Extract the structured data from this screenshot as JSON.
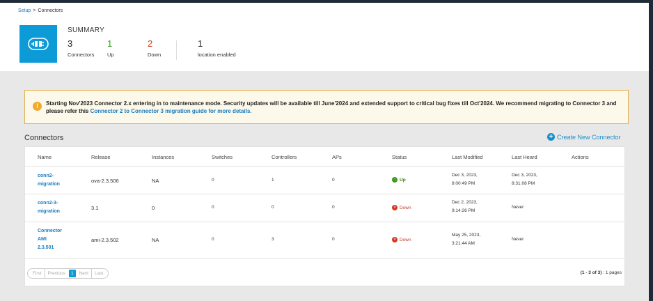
{
  "breadcrumb": {
    "root": "Setup",
    "separator": ">",
    "current": "Connectors"
  },
  "summary": {
    "title": "SUMMARY",
    "stats": [
      {
        "value": "3",
        "label": "Connectors"
      },
      {
        "value": "1",
        "label": "Up"
      },
      {
        "value": "2",
        "label": "Down"
      },
      {
        "value": "1",
        "label": "location enabled"
      }
    ]
  },
  "alert": {
    "icon": "!",
    "text": "Starting Nov'2023 Connector 2.x entering in to maintenance mode. Security updates will be available till June'2024 and extended support to critical bug fixes till Oct'2024. We recommend migrating to Connector 3 and please refer this ",
    "link_text": "Connector 2 to Connector 3 migration guide for more details."
  },
  "section": {
    "title": "Connectors",
    "create_label": "Create New Connector"
  },
  "table": {
    "columns": [
      "Name",
      "Release",
      "Instances",
      "Switches",
      "Controllers",
      "APs",
      "Status",
      "Last Modified",
      "Last Heard",
      "Actions"
    ],
    "rows": [
      {
        "name_l1": "conn2-",
        "name_l2": "migration",
        "name_l3": "",
        "release": "ova-2.3.506",
        "instances": "NA",
        "switches": "0",
        "controllers": "1",
        "aps": "0",
        "status": "Up",
        "modified_l1": "Dec 3, 2023,",
        "modified_l2": "8:00:49 PM",
        "heard_l1": "Dec 3, 2023,",
        "heard_l2": "8:31:08 PM"
      },
      {
        "name_l1": "conn2-3-",
        "name_l2": "migration",
        "name_l3": "",
        "release": "3.1",
        "instances": "0",
        "switches": "0",
        "controllers": "0",
        "aps": "0",
        "status": "Down",
        "modified_l1": "Dec 2, 2023,",
        "modified_l2": "9:14:26 PM",
        "heard_l1": "Never",
        "heard_l2": ""
      },
      {
        "name_l1": "Connector",
        "name_l2": "AMI",
        "name_l3": "2.3.501",
        "release": "ami-2.3.502",
        "instances": "NA",
        "switches": "0",
        "controllers": "3",
        "aps": "0",
        "status": "Down",
        "modified_l1": "May 25, 2023,",
        "modified_l2": "3:21:44 AM",
        "heard_l1": "Never",
        "heard_l2": ""
      }
    ]
  },
  "pagination": {
    "first": "First",
    "previous": "Previous",
    "current": "1",
    "next": "Next",
    "last": "Last",
    "range": "(1 - 3 of 3)",
    "pages": ": 1 pages"
  },
  "colors": {
    "accent": "#0d9bd8",
    "up": "#3a9a1c",
    "down": "#d6381f",
    "alert_border": "#e0b14a"
  },
  "icons": {
    "summary": "connector-plug-icon",
    "alert": "warning-icon",
    "create": "plus-circle-icon"
  }
}
